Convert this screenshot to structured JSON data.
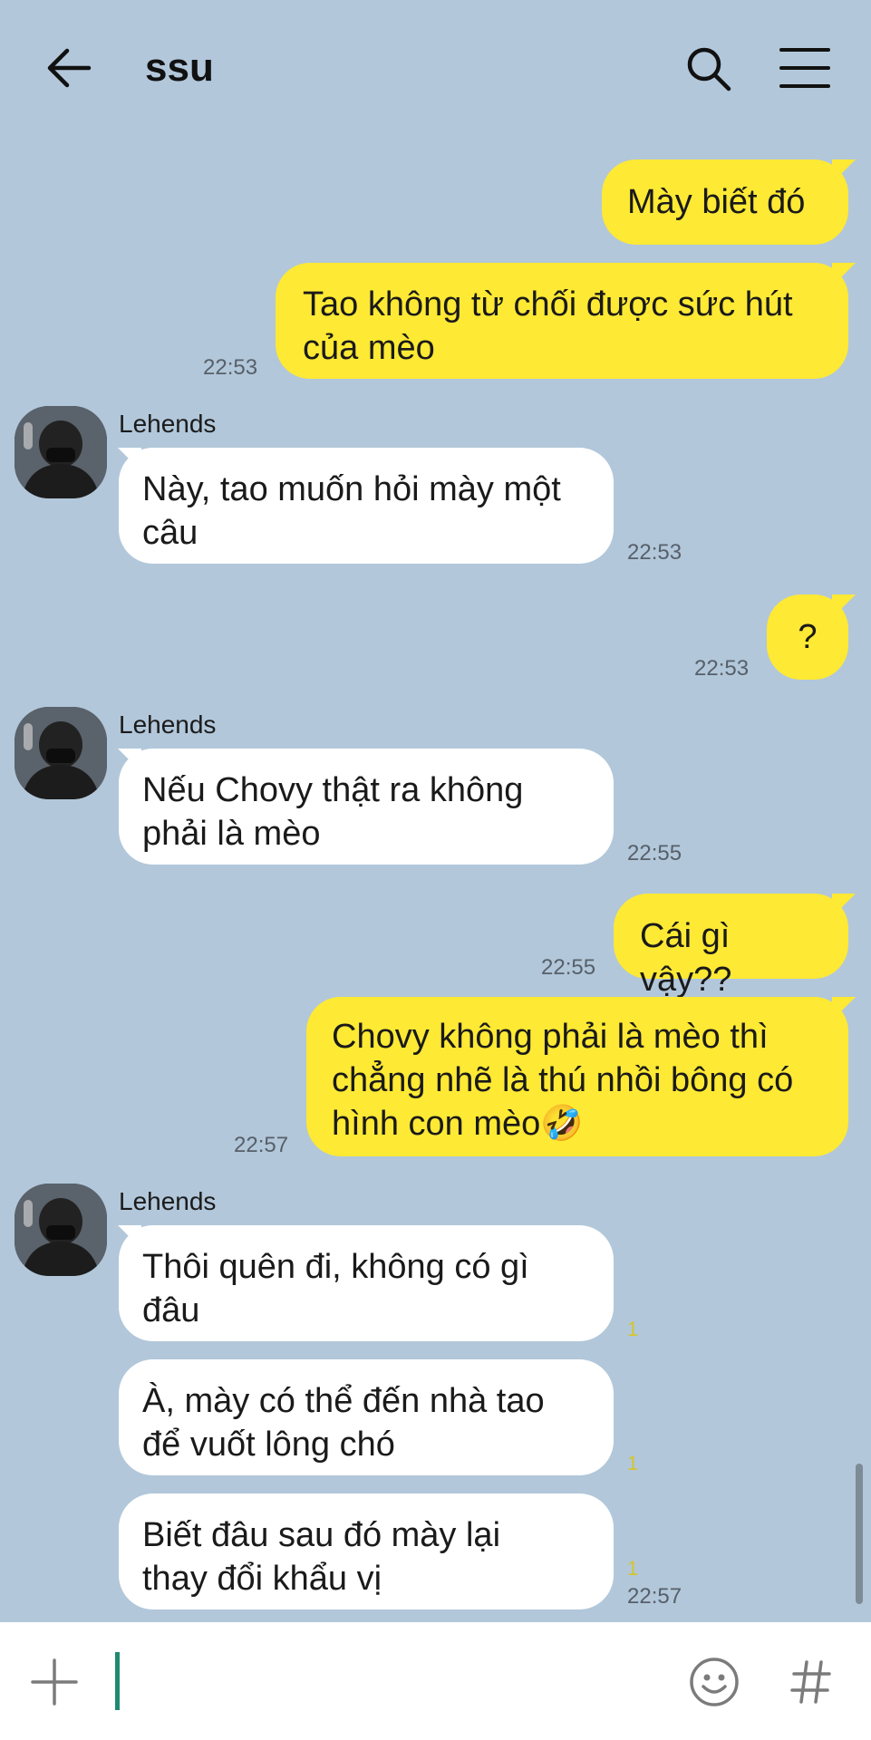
{
  "header": {
    "title": "ssu",
    "back_icon": "arrow-left-icon",
    "search_icon": "search-icon",
    "menu_icon": "hamburger-menu-icon"
  },
  "contact": {
    "name": "Lehends"
  },
  "messages": [
    {
      "dir": "out",
      "lines": "Mày biết đó",
      "time": ""
    },
    {
      "dir": "out",
      "lines": "Tao không từ chối được sức hút\ncủa mèo",
      "time": "22:53"
    },
    {
      "dir": "in",
      "sender": "Lehends",
      "lines": "Này, tao muốn hỏi mày một\ncâu",
      "time": "22:53"
    },
    {
      "dir": "out",
      "lines": "?",
      "time": "22:53"
    },
    {
      "dir": "in",
      "sender": "Lehends",
      "lines": "Nếu Chovy thật ra không\nphải là mèo",
      "time": "22:55"
    },
    {
      "dir": "out",
      "lines": "Cái gì vậy??",
      "time": "22:55"
    },
    {
      "dir": "out",
      "lines": "Chovy không phải là mèo thì\nchẳng nhẽ là thú nhồi bông có\nhình con mèo🤣",
      "time": "22:57"
    },
    {
      "dir": "in",
      "sender": "Lehends",
      "lines": "Thôi quên đi, không có gì\nđâu",
      "unread": "1",
      "time": ""
    },
    {
      "dir": "in",
      "lines": "À, mày có thể đến nhà tao\nđể vuốt lông chó",
      "unread": "1",
      "time": ""
    },
    {
      "dir": "in",
      "lines": "Biết đâu sau đó mày lại\nthay đổi khẩu vị",
      "unread": "1",
      "time": "22:57"
    }
  ],
  "input": {
    "plus_icon": "plus-icon",
    "emoji_icon": "emoji-icon",
    "hashtag_icon": "hashtag-icon",
    "value": ""
  },
  "colors": {
    "background": "#b2c7da",
    "outgoing_bubble": "#fee934",
    "incoming_bubble": "#ffffff",
    "cursor": "#1f8a70"
  }
}
